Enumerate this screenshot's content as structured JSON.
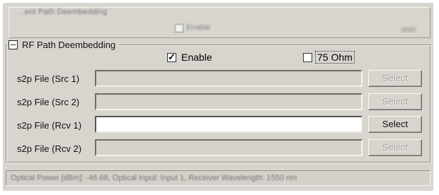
{
  "top_panel": {
    "title": "...ent Path Deembedding",
    "enable_label": "Enable"
  },
  "group": {
    "title": "RF Path Deembedding",
    "collapse_symbol": "−",
    "enable": {
      "label": "Enable",
      "checked": true
    },
    "ohm75": {
      "label": "75 Ohm",
      "checked": false
    },
    "rows": [
      {
        "label": "s2p File (Src 1)",
        "value": "",
        "button": "Select",
        "enabled": false
      },
      {
        "label": "s2p File (Src 2)",
        "value": "",
        "button": "Select",
        "enabled": false
      },
      {
        "label": "s2p File (Rcv 1)",
        "value": "",
        "button": "Select",
        "enabled": true
      },
      {
        "label": "s2p File (Rcv 2)",
        "value": "",
        "button": "Select",
        "enabled": false
      }
    ]
  },
  "status_bar": {
    "text": "Optical Power [dBm]: -46.68,  Optical Input: Input 1, Receiver Wavelength: 1550 nm"
  }
}
